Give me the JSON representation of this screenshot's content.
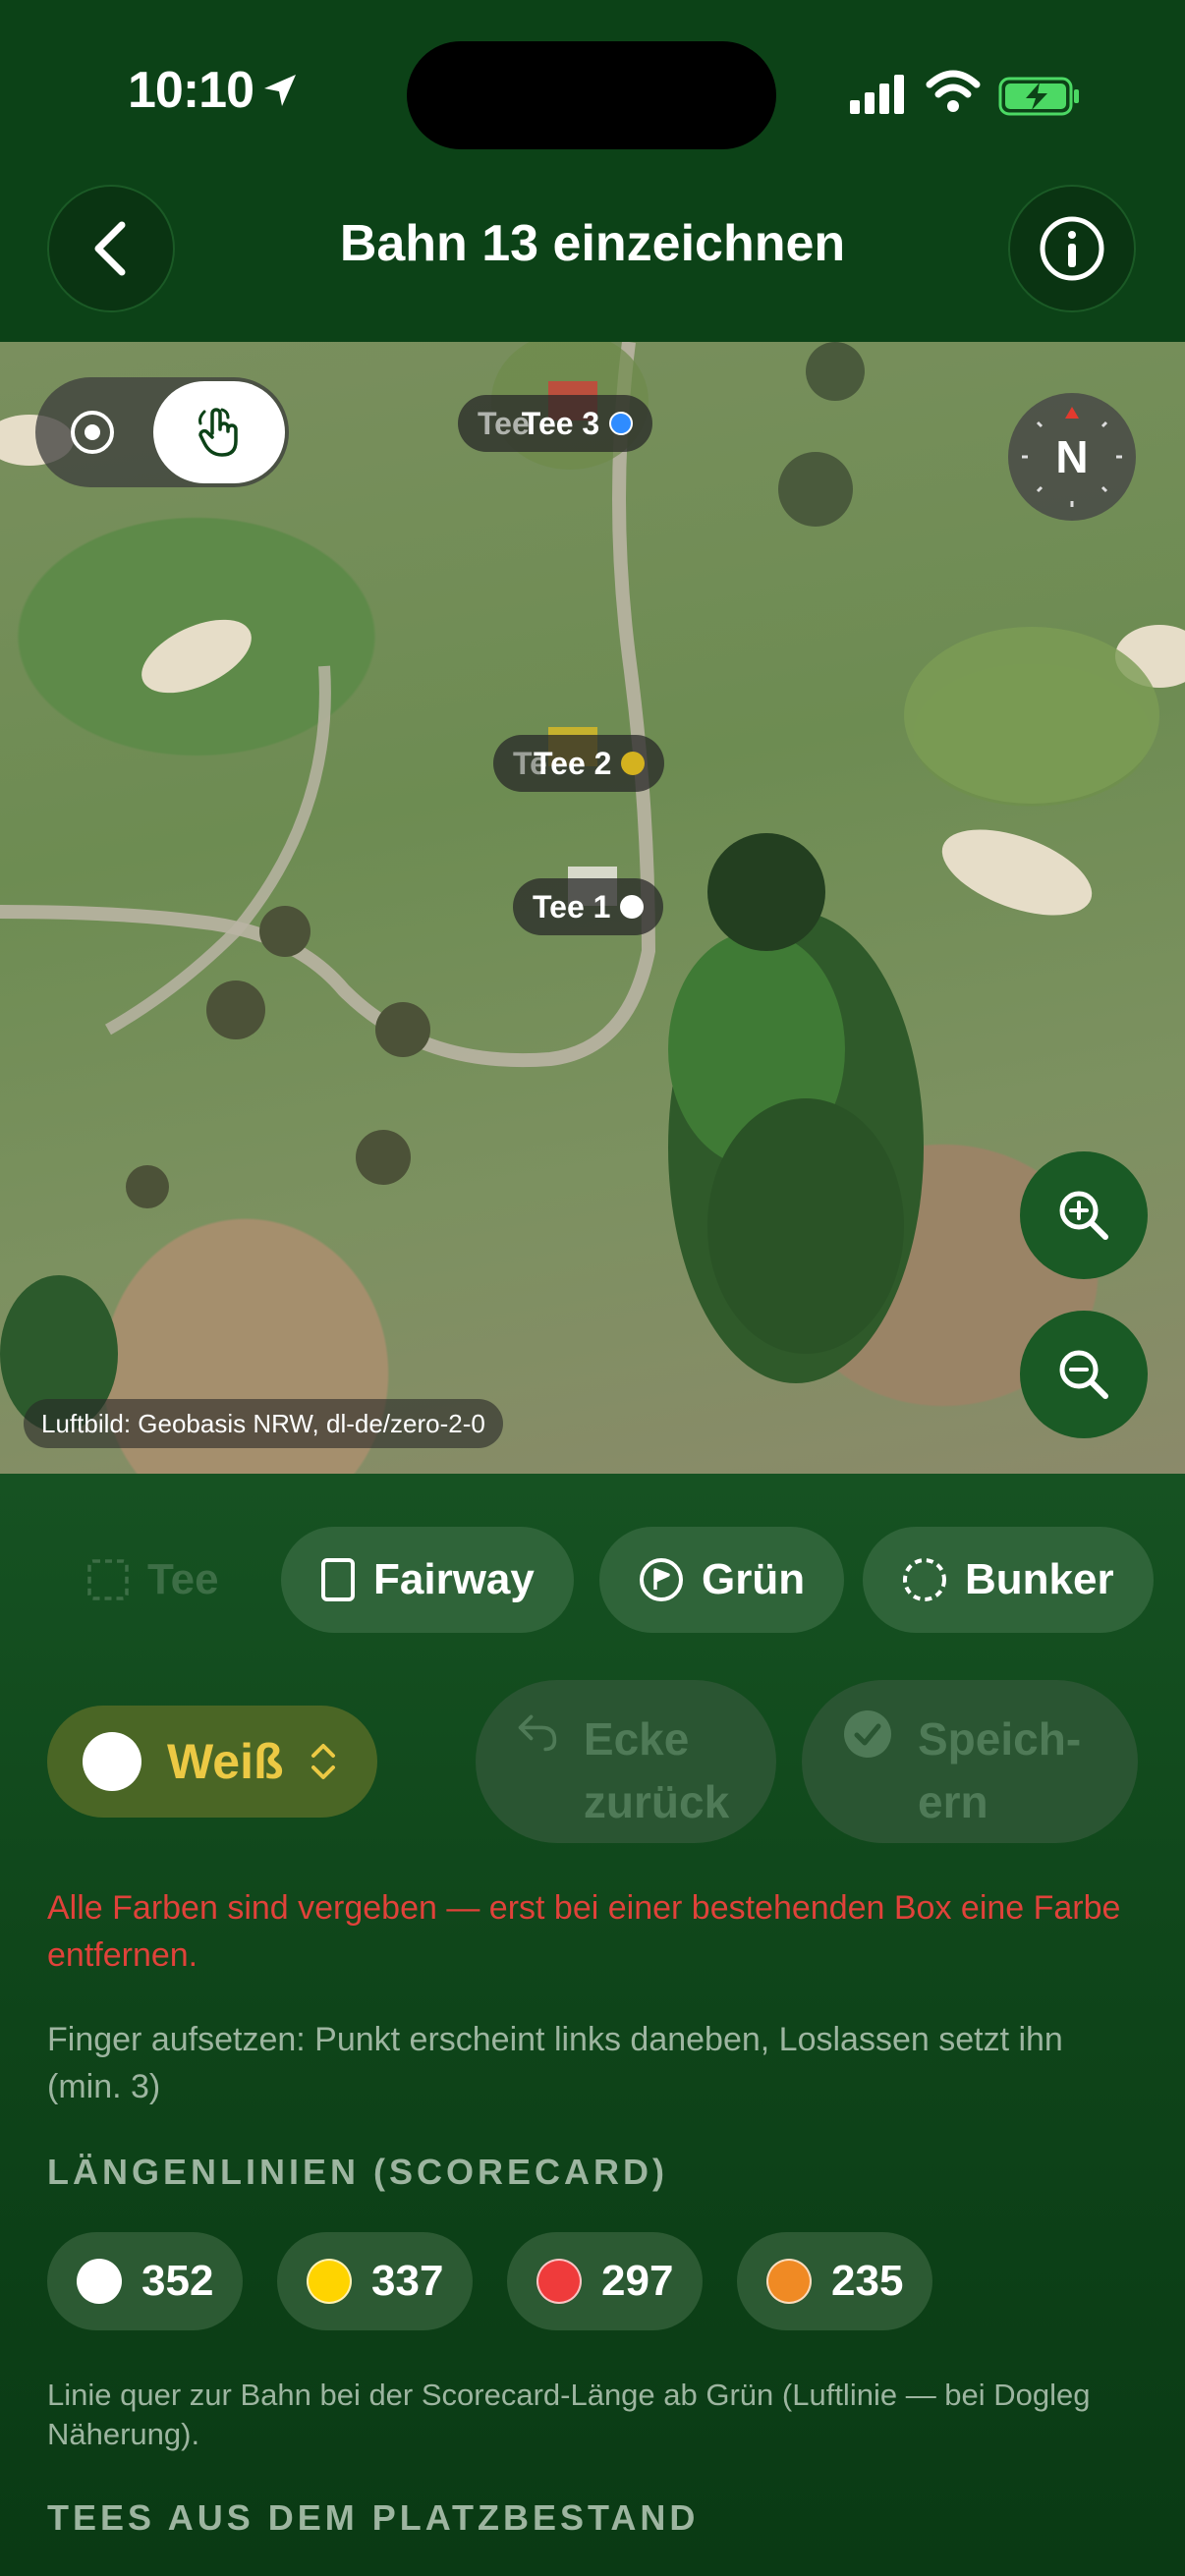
{
  "status_bar": {
    "time": "10:10"
  },
  "header": {
    "title": "Bahn 13 einzeichnen"
  },
  "map": {
    "compass_label": "N",
    "tee_labels": [
      {
        "label": "Tee 3",
        "ghost": "Tee",
        "color": "#2f8cff"
      },
      {
        "label": "Tee 2",
        "ghost": "Te",
        "color": "#d4b21f"
      },
      {
        "label": "Tee 1",
        "ghost": "",
        "color": "#ffffff"
      }
    ],
    "attribution": "Luftbild: Geobasis NRW, dl-de/zero-2-0"
  },
  "shape_chips": [
    {
      "label": "Tee",
      "icon": "dashed-square-icon",
      "enabled": false
    },
    {
      "label": "Fairway",
      "icon": "rectangle-icon",
      "enabled": true
    },
    {
      "label": "Grün",
      "icon": "flag-icon",
      "enabled": true
    },
    {
      "label": "Bunker",
      "icon": "dashed-circle-icon",
      "enabled": true
    }
  ],
  "color_select": {
    "label": "Weiß",
    "color": "#ffffff"
  },
  "actions": {
    "undo_corner": "Ecke\nzurück",
    "undo_corner_l1": "Ecke",
    "undo_corner_l2": "zurück",
    "save_l1": "Speich-",
    "save_l2": "ern"
  },
  "error_message": "Alle Farben sind vergeben — erst bei einer bestehenden Box eine Farbe entfernen.",
  "hint_message": "Finger aufsetzen: Punkt erscheint links daneben, Loslassen setzt ihn (min. 3)",
  "length_section": {
    "title": "LÄNGENLINIEN (SCORECARD)",
    "items": [
      {
        "value": "352",
        "color": "#ffffff"
      },
      {
        "value": "337",
        "color": "#ffd400"
      },
      {
        "value": "297",
        "color": "#ef3b3b"
      },
      {
        "value": "235",
        "color": "#f08a24"
      }
    ],
    "note": "Linie quer zur Bahn bei der Scorecard-Länge ab Grün (Luftlinie — bei Dogleg Näherung)."
  },
  "tees_section": {
    "title": "TEES AUS DEM PLATZBESTAND"
  }
}
